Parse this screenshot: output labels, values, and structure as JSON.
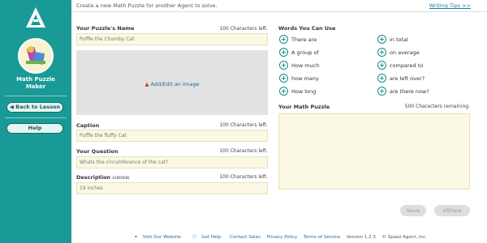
{
  "header": {
    "intro": "Create a new Math Puzzle for another Agent to solve.",
    "tips_link": "Writing Tips >>"
  },
  "sidebar": {
    "app_name_line1": "Math Puzzle",
    "app_name_line2": "Maker",
    "back_button": "◀ Back to Lesson",
    "help_button": "Help"
  },
  "form": {
    "puzzle_name": {
      "label": "Your Puzzle's Name",
      "count": "100 Characters left.",
      "value": "Puffle the Chomby Cat"
    },
    "image": {
      "link": "Add/Edit an Image"
    },
    "caption": {
      "label": "Caption",
      "count": "100 Characters left.",
      "value": "Puffle the fluffy Cat"
    },
    "question": {
      "label": "Your Question",
      "count": "100 Characters left.",
      "value": "Whats the circumference of the cat?"
    },
    "description": {
      "label": "Description",
      "label_hint": "(HIDDEN)",
      "count": "100 Characters left.",
      "value": "19 inches"
    }
  },
  "words": {
    "label": "Words You Can Use",
    "left_column": [
      "There are",
      "A group of",
      "How much",
      "how many",
      "How long"
    ],
    "right_column": [
      "in total",
      "on average",
      "compared to",
      "are left over?",
      "are there now?"
    ]
  },
  "puzzle": {
    "label": "Your Math Puzzle",
    "count": "500 Characters remaining.",
    "value": ""
  },
  "actions": {
    "save": "Save",
    "share": "Share"
  },
  "footer": {
    "links": [
      "Visit Our Website",
      "Get Help",
      "Contact Sales",
      "Privacy Policy",
      "Terms of Service"
    ],
    "version": "Version 1.2.3",
    "copyright": "© Spaaz Agent, Inc."
  }
}
